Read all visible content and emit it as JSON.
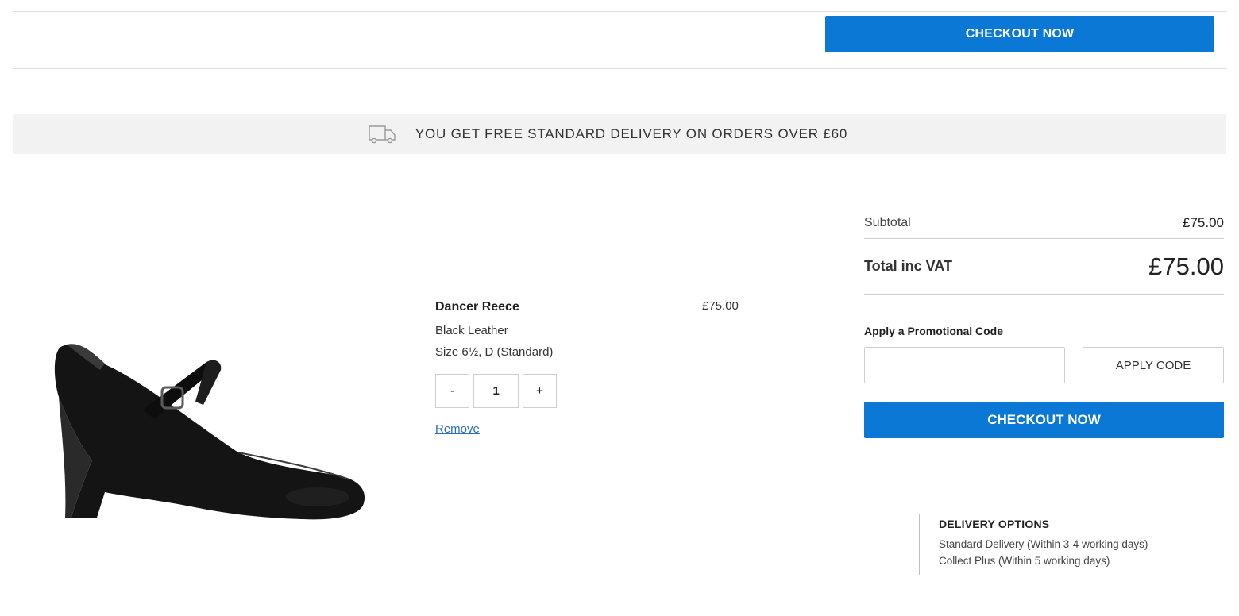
{
  "header": {
    "checkout_label": "CHECKOUT NOW"
  },
  "delivery_banner": {
    "icon": "delivery-van-icon",
    "text": "YOU GET FREE STANDARD DELIVERY ON ORDERS OVER £60"
  },
  "cart_item": {
    "name": "Dancer Reece",
    "price": "£75.00",
    "colour": "Black Leather",
    "size": "Size 6½, D (Standard)",
    "quantity": "1",
    "decrement_label": "-",
    "increment_label": "+",
    "remove_label": "Remove"
  },
  "summary": {
    "subtotal_label": "Subtotal",
    "subtotal_value": "£75.00",
    "total_label": "Total inc VAT",
    "total_value": "£75.00",
    "promo_label": "Apply a Promotional Code",
    "promo_placeholder": "",
    "apply_label": "APPLY CODE",
    "checkout_label": "CHECKOUT NOW"
  },
  "delivery_options": {
    "heading": "DELIVERY OPTIONS",
    "options": [
      "Standard Delivery (Within 3-4 working days)",
      "Collect Plus (Within 5 working days)"
    ]
  },
  "colors": {
    "accent": "#0a78d4",
    "banner_bg": "#f2f2f2",
    "link": "#2b6fb8"
  }
}
